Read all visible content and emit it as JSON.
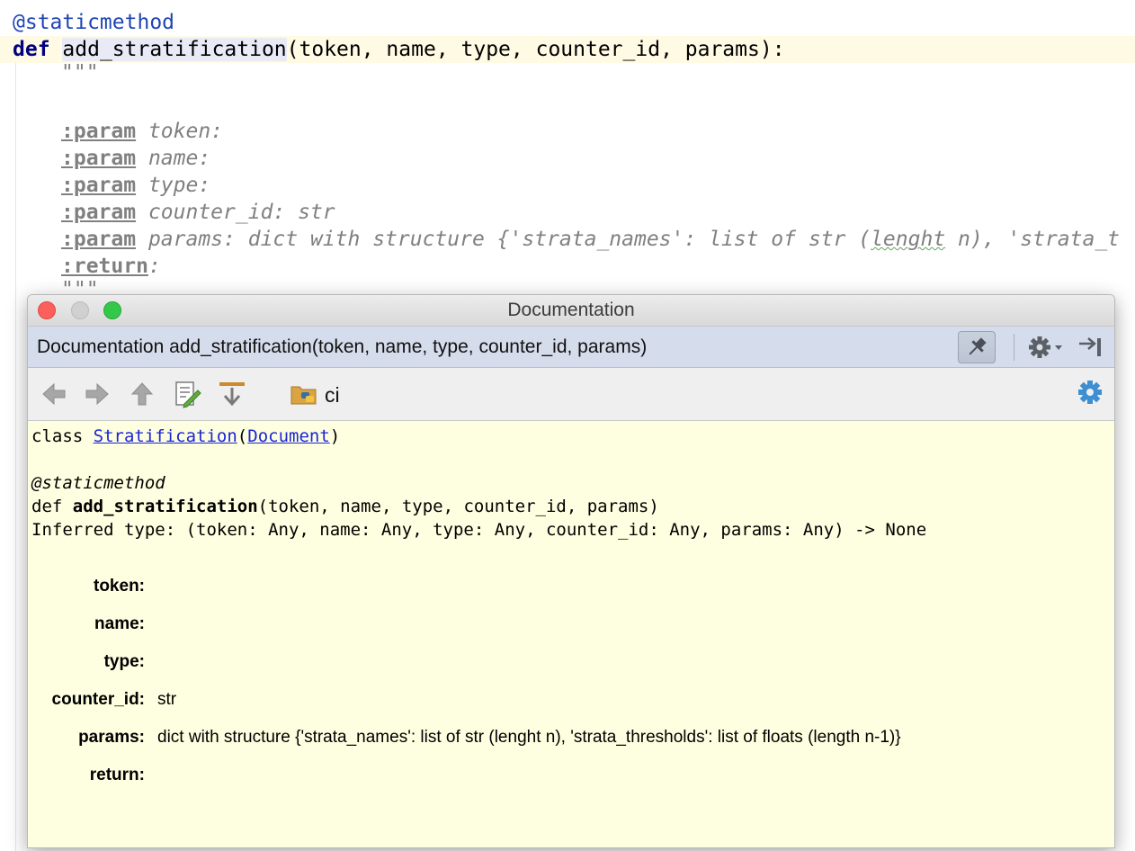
{
  "editor": {
    "lines": {
      "decorator": "@staticmethod",
      "def_kw": "def",
      "func_name": "add_stratification",
      "func_sig": "(token, name, type, counter_id, params):",
      "doc_open": "\"\"\"",
      "p1_tag": ":param",
      "p1_text": " token:",
      "p2_tag": ":param",
      "p2_text": " name:",
      "p3_tag": ":param",
      "p3_text": " type:",
      "p4_tag": ":param",
      "p4_text": " counter_id: str",
      "p5_tag": ":param",
      "p5_text_a": " params: dict with structure {'strata_names': list of str (",
      "p5_text_b": "lenght",
      "p5_text_c": " n), 'strata_t",
      "ret_tag": ":return",
      "ret_text": ":",
      "doc_close": "\"\"\""
    }
  },
  "doc_window": {
    "title": "Documentation",
    "header_title": "Documentation add_stratification(token, name, type, counter_id, params)",
    "toolbar": {
      "location": "ci"
    },
    "content": {
      "class_kw": "class ",
      "class_name": "Stratification",
      "paren_open": "(",
      "base_class": "Document",
      "paren_close": ")",
      "decorator": "@staticmethod",
      "def_kw": "def ",
      "func_name": "add_stratification",
      "func_args": "(token, name, type, counter_id, params)",
      "inferred": "Inferred type: (token: Any, name: Any, type: Any, counter_id: Any, params: Any) -> None",
      "params": [
        {
          "name": "token:",
          "desc": ""
        },
        {
          "name": "name:",
          "desc": ""
        },
        {
          "name": "type:",
          "desc": ""
        },
        {
          "name": "counter_id:",
          "desc": "str"
        },
        {
          "name": "params:",
          "desc": "dict with structure {'strata_names': list of str (lenght n), 'strata_thresholds': list of floats (length n-1)}"
        },
        {
          "name": "return:",
          "desc": ""
        }
      ]
    }
  },
  "icons": {
    "back": "back-arrow-icon",
    "forward": "forward-arrow-icon",
    "up": "up-arrow-icon",
    "edit_source": "edit-source-icon",
    "jump_down": "jump-to-source-icon",
    "python_package": "python-package-icon",
    "pin": "pin-icon",
    "gear": "gear-icon",
    "hide": "hide-panel-icon",
    "settings": "settings-gear-icon"
  },
  "colors": {
    "doc_background": "#fefee0",
    "header_background": "#d5dceb",
    "link": "#1a26d6",
    "keyword": "#000080",
    "docstring": "#808080"
  }
}
